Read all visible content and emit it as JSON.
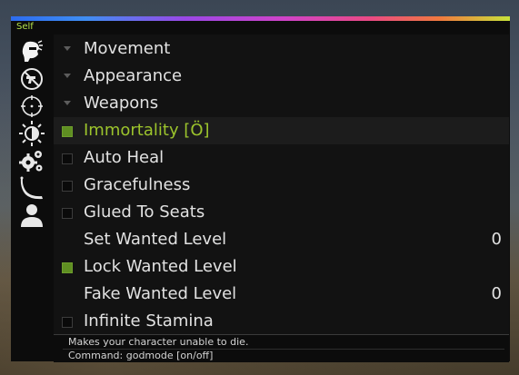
{
  "menu": {
    "title": "Self",
    "sidebar": {
      "items": [
        {
          "icon": "player-head-icon",
          "active": true
        },
        {
          "icon": "no-shooting-icon",
          "active": false
        },
        {
          "icon": "crosshair-icon",
          "active": false
        },
        {
          "icon": "brightness-icon",
          "active": false
        },
        {
          "icon": "gears-icon",
          "active": false
        },
        {
          "icon": "knife-icon",
          "active": false
        },
        {
          "icon": "person-icon",
          "active": false
        }
      ]
    },
    "items": [
      {
        "label": "Movement",
        "type": "submenu"
      },
      {
        "label": "Appearance",
        "type": "submenu"
      },
      {
        "label": "Weapons",
        "type": "submenu"
      },
      {
        "label": "Immortality [Ö]",
        "type": "toggle",
        "checked": true,
        "selected": true
      },
      {
        "label": "Auto Heal",
        "type": "toggle",
        "checked": false
      },
      {
        "label": "Gracefulness",
        "type": "toggle",
        "checked": false
      },
      {
        "label": "Glued To Seats",
        "type": "toggle",
        "checked": false
      },
      {
        "label": "Set Wanted Level",
        "type": "number",
        "value": "0"
      },
      {
        "label": "Lock Wanted Level",
        "type": "toggle",
        "checked": true
      },
      {
        "label": "Fake Wanted Level",
        "type": "number",
        "value": "0"
      },
      {
        "label": "Infinite Stamina",
        "type": "toggle",
        "checked": false
      }
    ],
    "footer": {
      "description": "Makes your character unable to die.",
      "command": "Command: godmode [on/off]"
    },
    "colors": {
      "accent": "#9cc42c",
      "check_on": "#5f8f22",
      "panel": "#121212"
    }
  }
}
